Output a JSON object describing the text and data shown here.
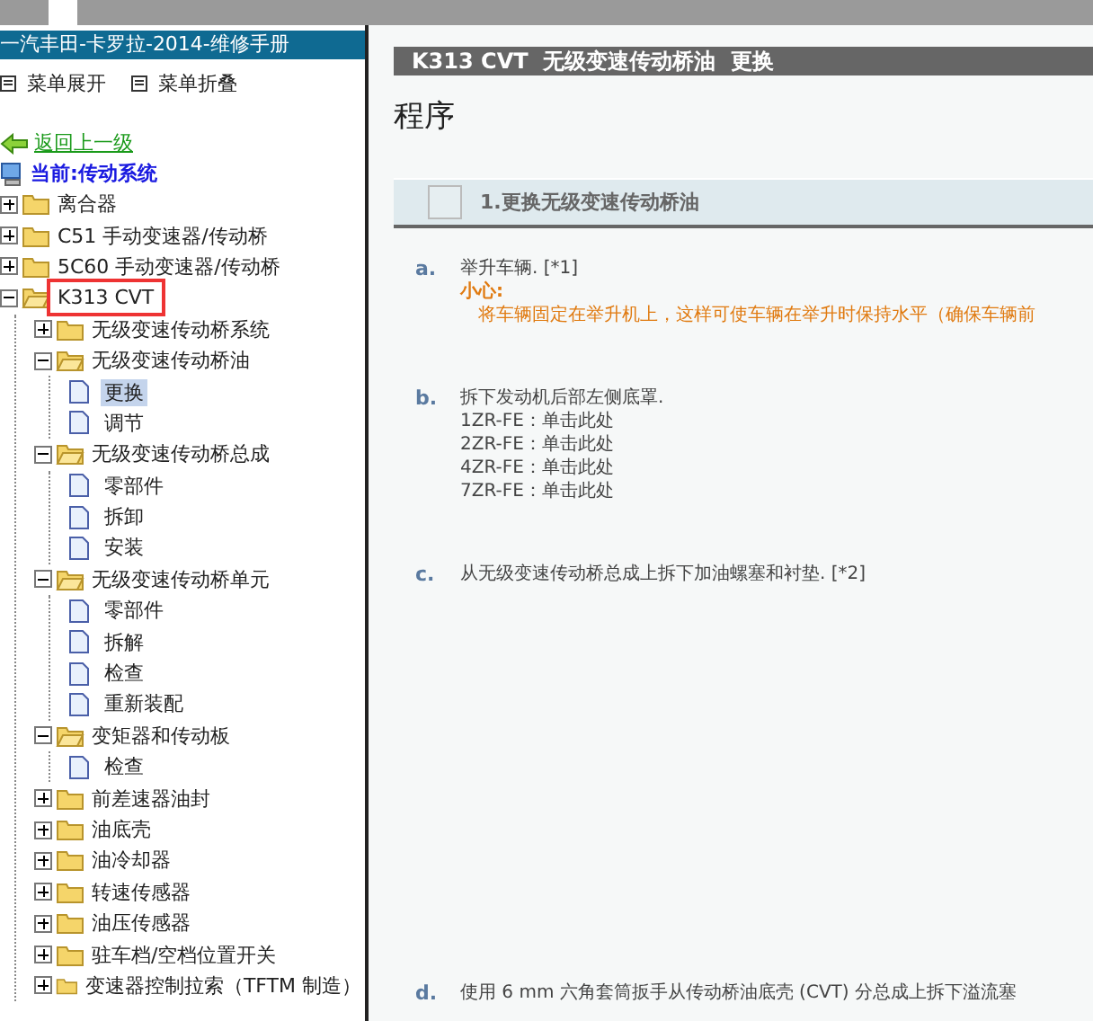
{
  "sidebar": {
    "title": "一汽丰田-卡罗拉-2014-维修手册",
    "menu_actions": [
      "菜单展开",
      "菜单折叠"
    ],
    "back_link": "返回上一级",
    "current": "当前:传动系统",
    "tree": [
      {
        "kind": "folder",
        "label": "离合器",
        "expanded": false,
        "highlighted": false
      },
      {
        "kind": "folder",
        "label": "C51 手动变速器/传动桥",
        "expanded": false,
        "highlighted": false
      },
      {
        "kind": "folder",
        "label": "5C60 手动变速器/传动桥",
        "expanded": false,
        "highlighted": false
      },
      {
        "kind": "folder",
        "label": "K313 CVT",
        "expanded": true,
        "highlighted": true,
        "children": [
          {
            "kind": "folder",
            "label": "无级变速传动桥系统",
            "expanded": false,
            "highlighted": false
          },
          {
            "kind": "folder",
            "label": "无级变速传动桥油",
            "expanded": true,
            "highlighted": false,
            "children": [
              {
                "kind": "page",
                "label": "更换",
                "selected": true
              },
              {
                "kind": "page",
                "label": "调节",
                "selected": false
              }
            ]
          },
          {
            "kind": "folder",
            "label": "无级变速传动桥总成",
            "expanded": true,
            "highlighted": false,
            "children": [
              {
                "kind": "page",
                "label": "零部件",
                "selected": false
              },
              {
                "kind": "page",
                "label": "拆卸",
                "selected": false
              },
              {
                "kind": "page",
                "label": "安装",
                "selected": false
              }
            ]
          },
          {
            "kind": "folder",
            "label": "无级变速传动桥单元",
            "expanded": true,
            "highlighted": false,
            "children": [
              {
                "kind": "page",
                "label": "零部件",
                "selected": false
              },
              {
                "kind": "page",
                "label": "拆解",
                "selected": false
              },
              {
                "kind": "page",
                "label": "检查",
                "selected": false
              },
              {
                "kind": "page",
                "label": "重新装配",
                "selected": false
              }
            ]
          },
          {
            "kind": "folder",
            "label": "变矩器和传动板",
            "expanded": true,
            "highlighted": false,
            "children": [
              {
                "kind": "page",
                "label": "检查",
                "selected": false
              }
            ]
          },
          {
            "kind": "folder",
            "label": "前差速器油封",
            "expanded": false,
            "highlighted": false
          },
          {
            "kind": "folder",
            "label": "油底壳",
            "expanded": false,
            "highlighted": false
          },
          {
            "kind": "folder",
            "label": "油冷却器",
            "expanded": false,
            "highlighted": false
          },
          {
            "kind": "folder",
            "label": "转速传感器",
            "expanded": false,
            "highlighted": false
          },
          {
            "kind": "folder",
            "label": "油压传感器",
            "expanded": false,
            "highlighted": false
          },
          {
            "kind": "folder",
            "label": "驻车档/空档位置开关",
            "expanded": false,
            "highlighted": false
          },
          {
            "kind": "folder",
            "label": "变速器控制拉索（TFTM 制造）",
            "expanded": false,
            "highlighted": false
          }
        ]
      }
    ]
  },
  "content": {
    "header": "K313 CVT  无级变速传动桥油  更换",
    "heading": "程序",
    "step": {
      "title": "1.更换无级变速传动桥油",
      "checked": false
    },
    "items": [
      {
        "marker": "a.",
        "lines": [
          "举升车辆. [*1]"
        ],
        "caution_label": "小心:",
        "caution_text": "将车辆固定在举升机上，这样可使车辆在举升时保持水平（确保车辆前"
      },
      {
        "marker": "b.",
        "lines": [
          "拆下发动机后部左侧底罩.",
          "1ZR-FE：单击此处",
          "2ZR-FE：单击此处",
          "4ZR-FE：单击此处",
          "7ZR-FE：单击此处"
        ]
      },
      {
        "marker": "c.",
        "lines": [
          "从无级变速传动桥总成上拆下加油螺塞和衬垫. [*2]"
        ]
      },
      {
        "marker": "d.",
        "lines": [
          "使用 6 mm 六角套筒扳手从传动桥油底壳 (CVT) 分总成上拆下溢流塞"
        ]
      }
    ]
  }
}
